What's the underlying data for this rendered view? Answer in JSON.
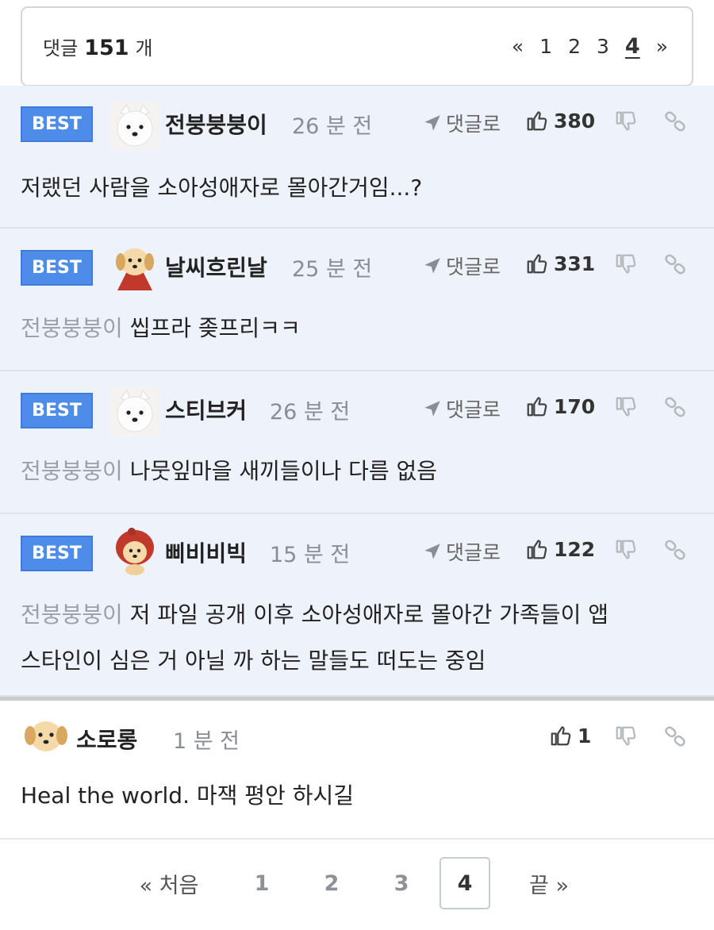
{
  "header": {
    "count_label": "댓글",
    "count_value": "151",
    "count_unit": "개",
    "pager": {
      "prev": "«",
      "pages": [
        "1",
        "2",
        "3",
        "4"
      ],
      "current": "4",
      "next": "»"
    }
  },
  "actions": {
    "reply_label": "댓글로"
  },
  "comments": [
    {
      "best": "BEST",
      "avatar": "white-dog",
      "name": "전붕붕붕이",
      "time": "26 분 전",
      "likes": "380",
      "mention": "",
      "text": "저랬던 사람을 소아성애자로 몰아간거임...?"
    },
    {
      "best": "BEST",
      "avatar": "yellow-puppy-cape",
      "name": "날씨흐린날",
      "time": "25 분 전",
      "likes": "331",
      "mention": "전붕붕붕이",
      "text": "씹프라 좆프리ㅋㅋ"
    },
    {
      "best": "BEST",
      "avatar": "white-dog",
      "name": "스티브커",
      "time": "26 분 전",
      "likes": "170",
      "mention": "전붕붕붕이",
      "text": "나뭇잎마을 새끼들이나 다름 없음"
    },
    {
      "best": "BEST",
      "avatar": "puppy-red-hood",
      "name": "삐비비빅",
      "time": "15 분 전",
      "likes": "122",
      "mention": "전붕붕붕이",
      "text": "저 파일 공개 이후 소아성애자로 몰아간 가족들이 앱",
      "text2": "스타인이 심은 거 아닐 까 하는 말들도 떠도는 중임"
    },
    {
      "best": "",
      "avatar": "yellow-puppy",
      "name": "소로롱",
      "time": "1 분 전",
      "likes": "1",
      "mention": "",
      "text": "Heal the world. 마잭 평안 하시길"
    }
  ],
  "bottom_pager": {
    "first": "« 처음",
    "pages": [
      "1",
      "2",
      "3",
      "4"
    ],
    "current": "4",
    "last": "끝 »"
  },
  "colors": {
    "best_badge": "#4d8de9",
    "best_bg": "#eef2fb",
    "mention": "#9aa0a6"
  }
}
